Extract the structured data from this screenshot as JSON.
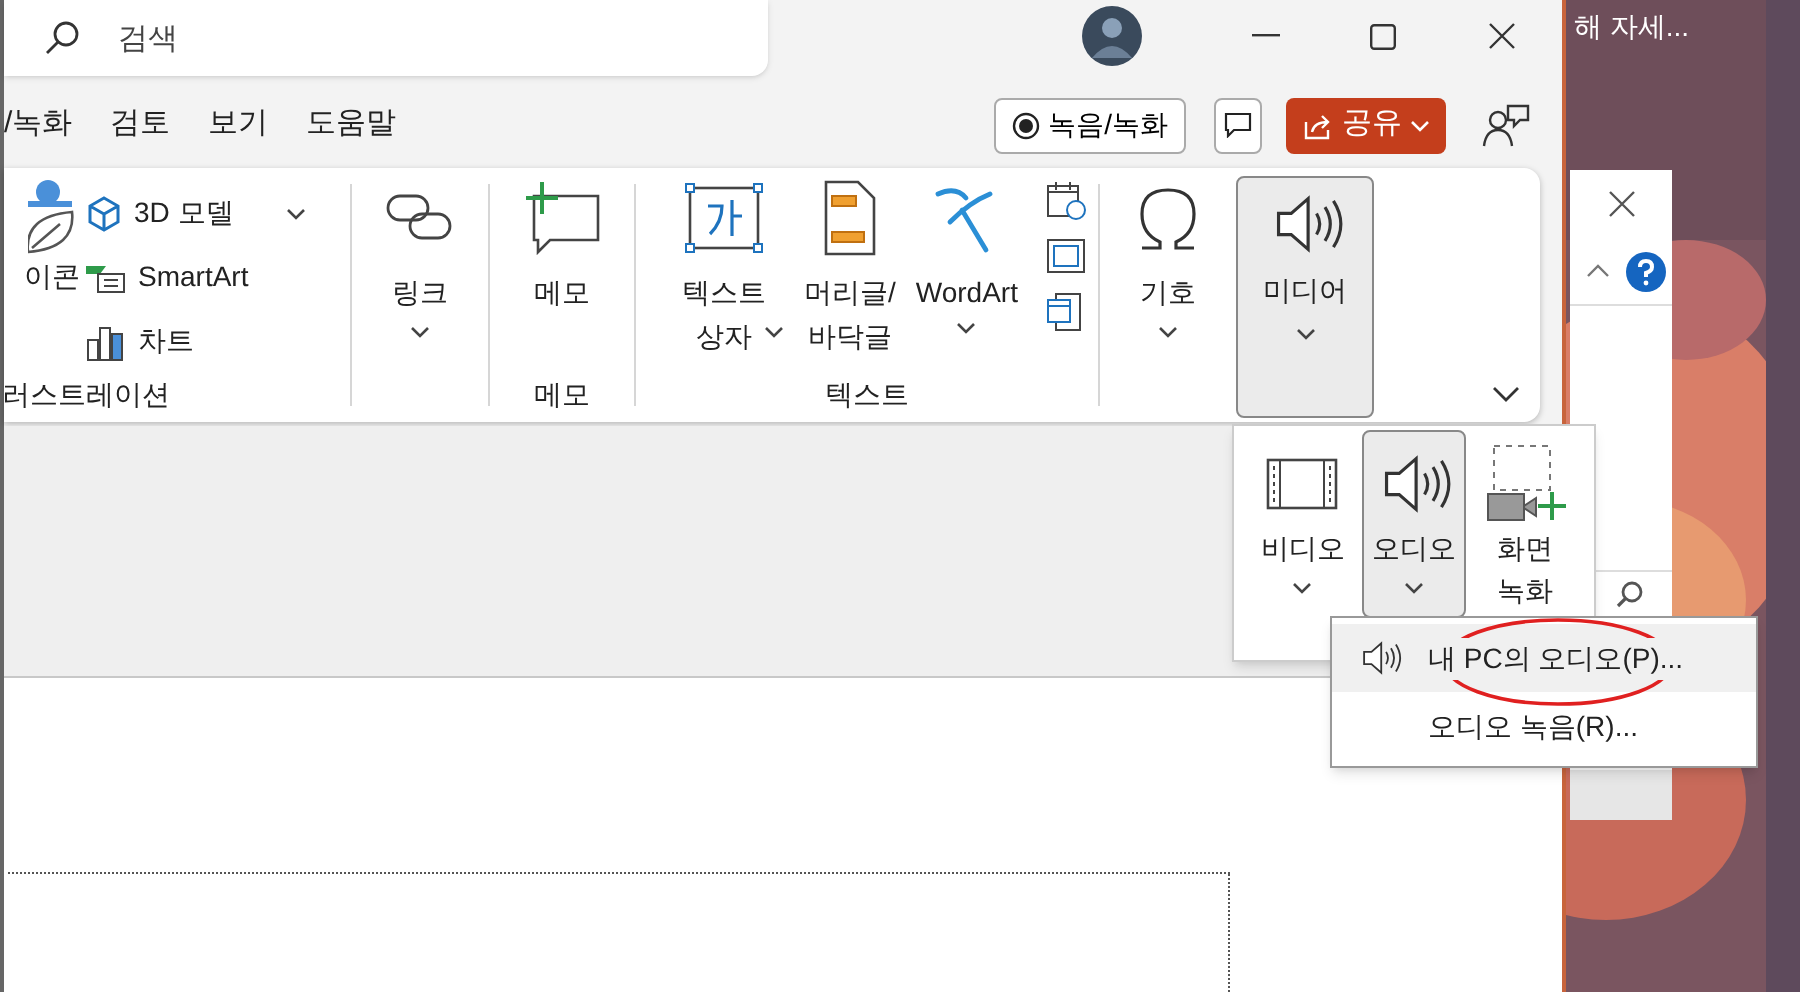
{
  "search": {
    "placeholder": "검색"
  },
  "tabs": [
    {
      "label": "/녹화",
      "selected": false
    },
    {
      "label": "검토",
      "selected": false
    },
    {
      "label": "보기",
      "selected": false
    },
    {
      "label": "도움말",
      "selected": false
    }
  ],
  "record_button": "녹음/녹화",
  "share_button": "공유",
  "ribbon": {
    "illustrations": {
      "icon_label": "이콘",
      "items": [
        "3D 모델",
        "SmartArt",
        "차트"
      ],
      "group_label": "러스트레이션"
    },
    "link": {
      "label": "링크"
    },
    "comment": {
      "label": "메모",
      "group_label": "메모"
    },
    "text": {
      "items": [
        "텍스트\n상자",
        "머리글/\n바닥글",
        "WordArt"
      ],
      "group_label": "텍스트"
    },
    "symbols": {
      "label": "기호"
    },
    "media": {
      "label": "미디어",
      "expanded": true
    }
  },
  "media_menu": {
    "items": [
      {
        "label": "비디오",
        "selected": false
      },
      {
        "label": "오디오",
        "selected": true
      },
      {
        "label": "화면\n녹화",
        "selected": false
      }
    ]
  },
  "audio_menu": {
    "items": [
      {
        "label": "내 PC의 오디오(P)...",
        "selected": true
      },
      {
        "label": "오디오 녹음(R)...",
        "selected": false
      }
    ]
  },
  "background_text": "해 자세..."
}
